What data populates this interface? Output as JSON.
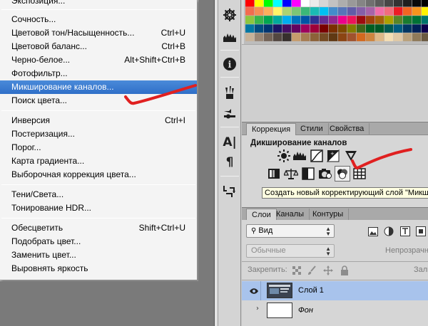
{
  "menu": {
    "top_cut": "Экспозиция...",
    "group1": [
      {
        "label": "Сочность...",
        "shortcut": ""
      },
      {
        "label": "Цветовой тон/Насыщенность...",
        "shortcut": "Ctrl+U"
      },
      {
        "label": "Цветовой баланс...",
        "shortcut": "Ctrl+B"
      },
      {
        "label": "Черно-белое...",
        "shortcut": "Alt+Shift+Ctrl+B"
      },
      {
        "label": "Фотофильтр...",
        "shortcut": ""
      },
      {
        "label": "Микширование каналов...",
        "shortcut": "",
        "highlighted": true
      },
      {
        "label": "Поиск цвета...",
        "shortcut": ""
      }
    ],
    "group2": [
      {
        "label": "Инверсия",
        "shortcut": "Ctrl+I"
      },
      {
        "label": "Постеризация...",
        "shortcut": ""
      },
      {
        "label": "Порог...",
        "shortcut": ""
      },
      {
        "label": "Карта градиента...",
        "shortcut": ""
      },
      {
        "label": "Выборочная коррекция цвета...",
        "shortcut": ""
      }
    ],
    "group3": [
      {
        "label": "Тени/Света...",
        "shortcut": ""
      },
      {
        "label": "Тонирование HDR...",
        "shortcut": ""
      }
    ],
    "group4": [
      {
        "label": "Обесцветить",
        "shortcut": "Shift+Ctrl+U"
      },
      {
        "label": "Подобрать цвет...",
        "shortcut": ""
      },
      {
        "label": "Заменить цвет...",
        "shortcut": ""
      },
      {
        "label": "Выровнять яркость",
        "shortcut": ""
      }
    ]
  },
  "tools": {
    "icons": [
      "swatch-dial-icon",
      "histogram-icon",
      "info-icon",
      "brushes-icon",
      "sliders-icon",
      "character-icon",
      "paragraph-icon",
      "history-icon"
    ],
    "char_glyph": "A|",
    "para_glyph": "¶",
    "info_glyph": "i"
  },
  "adjustments_panel": {
    "tabs": [
      "Коррекция",
      "Стили",
      "Свойства"
    ],
    "active_tab": "Коррекция",
    "title": "Дикширование каналов",
    "tooltip": "Создать новый корректирующий слой \"Микш"
  },
  "layers_panel": {
    "tabs": [
      "Слои",
      "Каналы",
      "Контуры"
    ],
    "active_tab": "Слои",
    "filter_label": "Вид",
    "blend_mode": "Обычные",
    "opacity_label": "Непрозрачн",
    "lock_label": "Закрепить:",
    "fill_label": "Зали",
    "layers": [
      {
        "name": "Слой 1",
        "italic": false,
        "selected": true
      },
      {
        "name": "Фон",
        "italic": true,
        "selected": false
      }
    ]
  },
  "colors": {
    "highlight": "#3a7bd5",
    "tooltip_bg": "#ffffe1",
    "selected_layer": "#a8c3ec",
    "annotation_red": "#e02020"
  }
}
